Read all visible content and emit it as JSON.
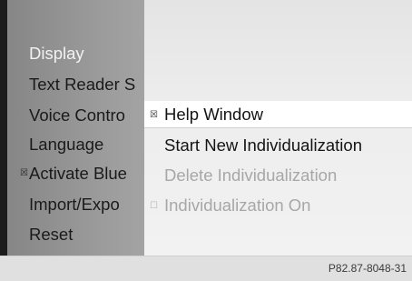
{
  "left_menu": {
    "items": [
      {
        "label": "Display"
      },
      {
        "label": "Text Reader S"
      },
      {
        "label": "Voice Contro"
      },
      {
        "label": "Language"
      },
      {
        "label": "Activate Blue",
        "checkbox": "☒"
      },
      {
        "label": "Import/Expo"
      },
      {
        "label": "Reset"
      }
    ]
  },
  "submenu": {
    "items": [
      {
        "label": "Help Window",
        "checkbox": "☒",
        "state": "selected"
      },
      {
        "label": "Start New Individualization",
        "state": "enabled"
      },
      {
        "label": "Delete Individualization",
        "state": "disabled"
      },
      {
        "label": "Individualization On",
        "checkbox": "☐",
        "state": "disabled"
      }
    ]
  },
  "footer": {
    "ref_code": "P82.87-8048-31"
  },
  "colors": {
    "left_panel": "#9a9a9a",
    "right_panel": "#ececec",
    "selected_row": "#ffffff",
    "disabled_text": "#a7a7a7",
    "highlight_text": "#f2f2f2"
  }
}
